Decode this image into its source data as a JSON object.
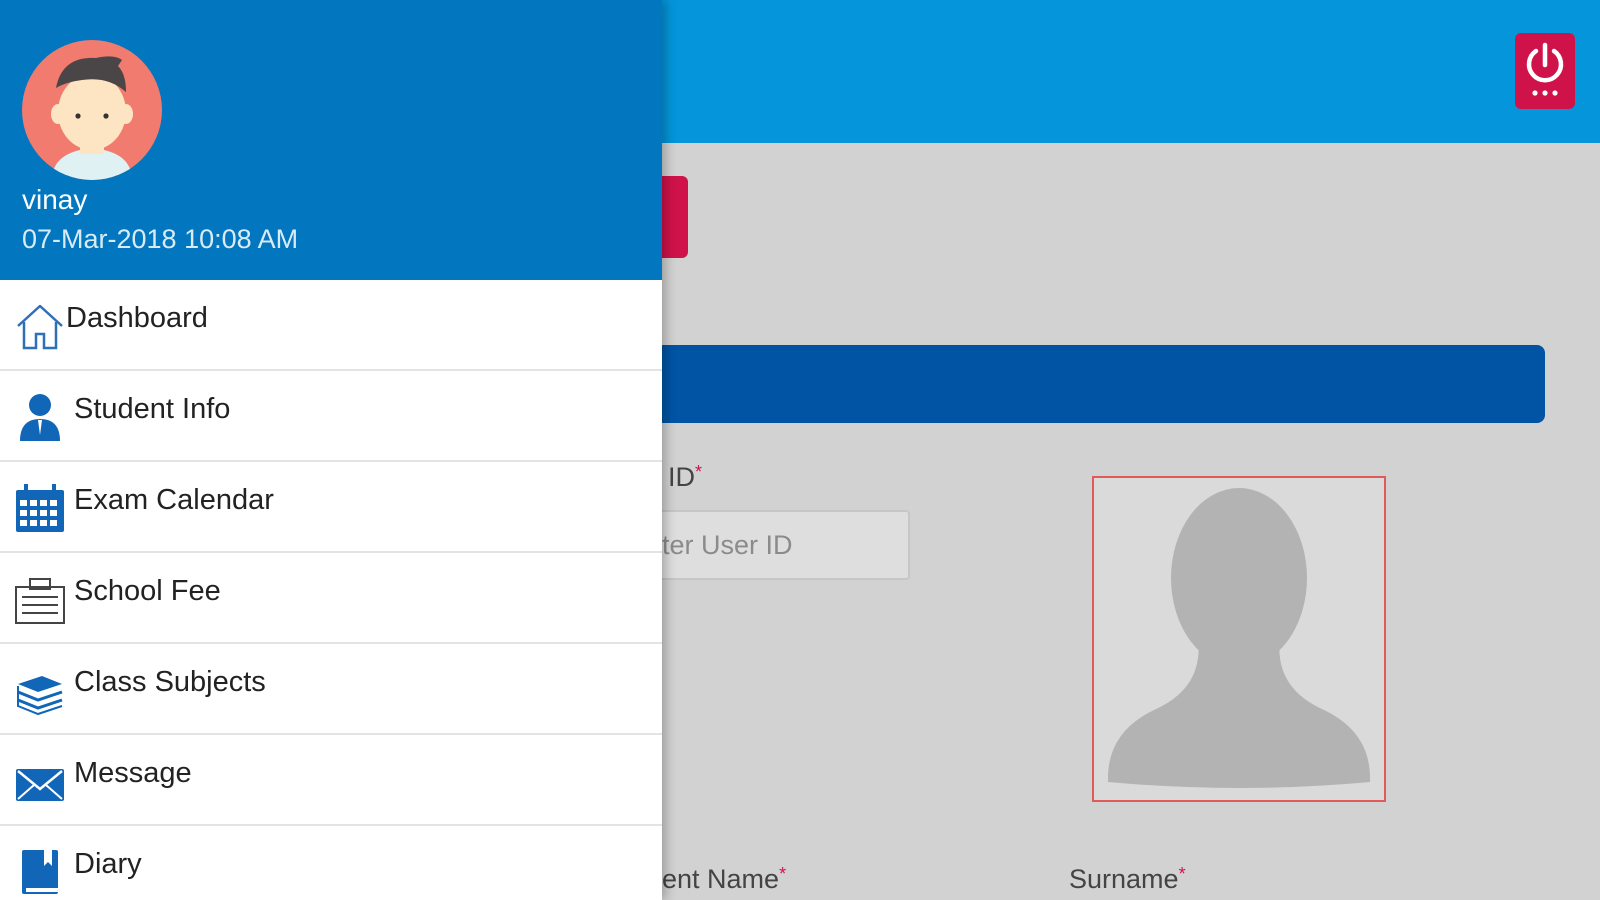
{
  "drawer": {
    "user_name": "vinay",
    "timestamp": "07-Mar-2018 10:08 AM",
    "menu": [
      {
        "label": "Dashboard",
        "icon": "home-icon"
      },
      {
        "label": "Student Info",
        "icon": "person-icon"
      },
      {
        "label": "Exam Calendar",
        "icon": "calendar-icon"
      },
      {
        "label": "School Fee",
        "icon": "clipboard-icon"
      },
      {
        "label": "Class Subjects",
        "icon": "books-icon"
      },
      {
        "label": "Message",
        "icon": "envelope-icon"
      },
      {
        "label": "Diary",
        "icon": "diary-icon"
      }
    ]
  },
  "header": {
    "power_icon": "power-icon"
  },
  "form": {
    "user_id_label": "ID",
    "user_id_placeholder": "ter User ID",
    "student_name_label": "ent Name",
    "surname_label": "Surname",
    "required_mark": "*"
  },
  "colors": {
    "drawer_header": "#0277bf",
    "topbar": "#0495da",
    "accent_red": "#d0124a",
    "section_bar": "#0154a4"
  }
}
